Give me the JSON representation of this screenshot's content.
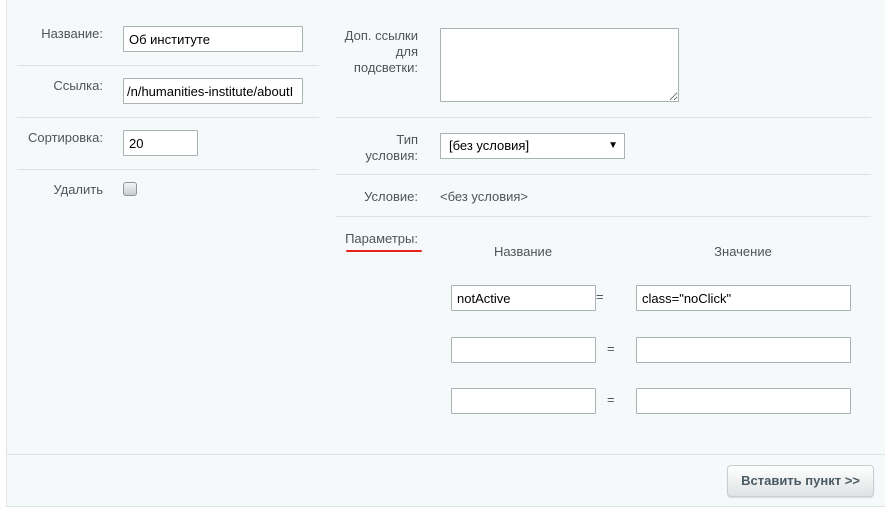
{
  "left": {
    "name_label": "Название:",
    "name_value": "Об институте",
    "link_label": "Ссылка:",
    "link_value": "/n/humanities-institute/aboutI",
    "sort_label": "Сортировка:",
    "sort_value": "20",
    "delete_label": "Удалить"
  },
  "right": {
    "extra_links_label": "Доп. ссылки для подсветки:",
    "extra_links_value": "",
    "condition_type_label": "Тип условия:",
    "condition_type_selected": "[без условия]",
    "condition_label": "Условие:",
    "condition_value": "<без условия>",
    "params_label": "Параметры:",
    "params_col_name": "Название",
    "params_col_value": "Значение",
    "params": [
      {
        "name": "notActive",
        "eq": "=",
        "value": "class=\"noClick\""
      },
      {
        "name": "",
        "eq": "=",
        "value": ""
      },
      {
        "name": "",
        "eq": "=",
        "value": ""
      }
    ]
  },
  "footer": {
    "insert_button": "Вставить пункт >>"
  },
  "colors": {
    "panel_bg": "#f5f9f9",
    "annotation_underline": "#e8231d"
  },
  "icons": {
    "select_arrow": "triangle-down-icon"
  }
}
